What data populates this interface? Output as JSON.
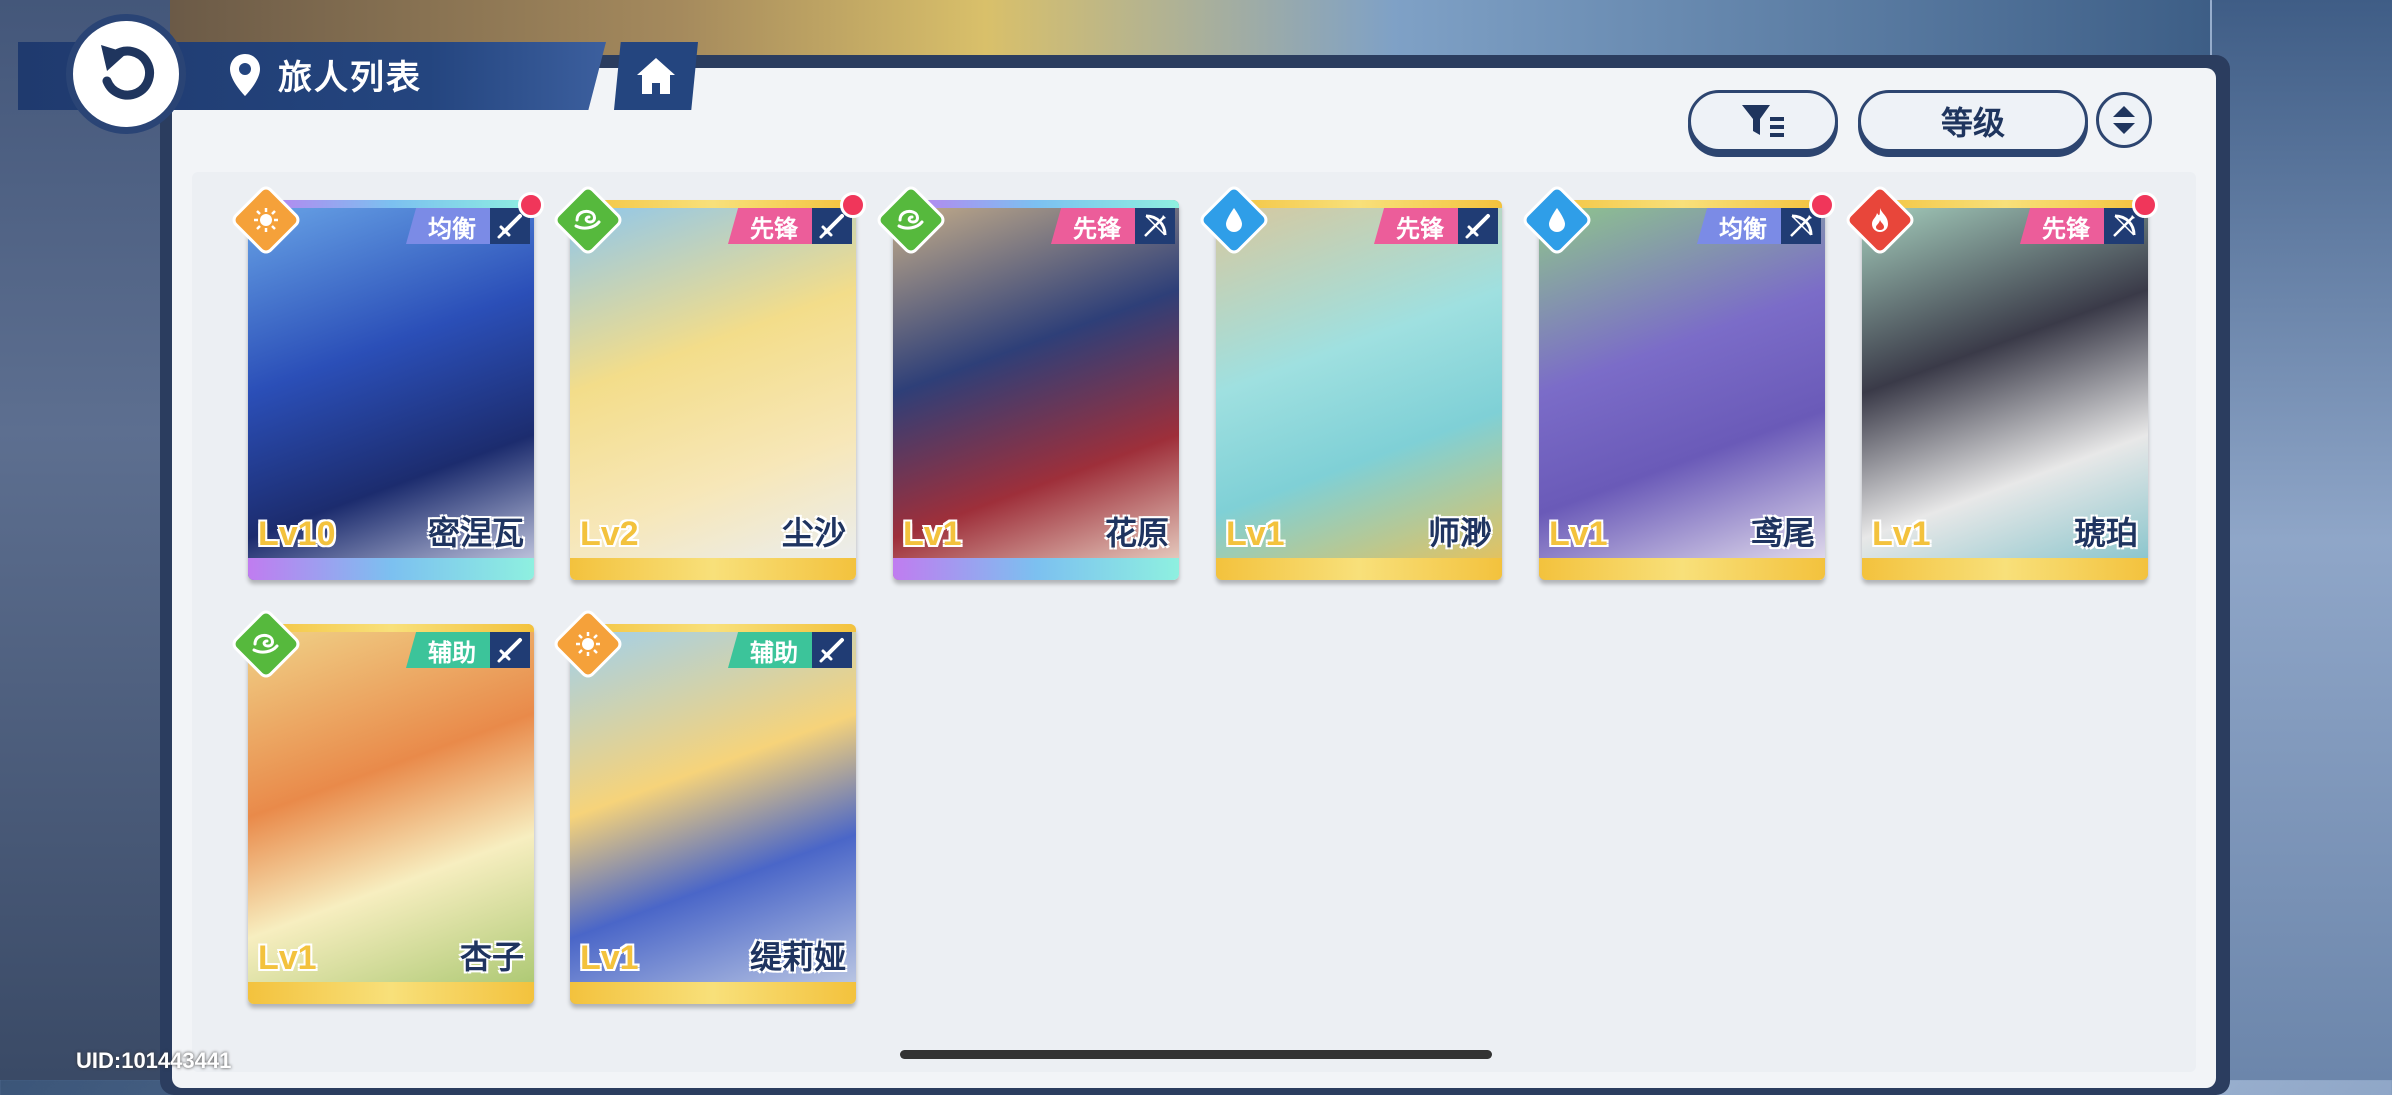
{
  "header": {
    "title": "旅人列表"
  },
  "controls": {
    "sort_label": "等级"
  },
  "colors": {
    "accent_navy": "#24457f",
    "role_balanced": "#7b8be6",
    "role_vanguard": "#ec5d9a",
    "role_support": "#3cc49a",
    "elem_sun": "#f5a13a",
    "elem_wind": "#56b93d",
    "elem_water": "#2f9ee8",
    "elem_fire": "#e8463a",
    "red_dot": "#f0365a"
  },
  "characters": [
    {
      "name": "密涅瓦",
      "level": "Lv10",
      "role": "均衡",
      "element": "sun-icon",
      "weapon": "sword-icon",
      "new": true,
      "rarity": "rainbow"
    },
    {
      "name": "尘沙",
      "level": "Lv2",
      "role": "先锋",
      "element": "wind-icon",
      "weapon": "sword-icon",
      "new": true,
      "rarity": "gold"
    },
    {
      "name": "花原",
      "level": "Lv1",
      "role": "先锋",
      "element": "wind-icon",
      "weapon": "bow-icon",
      "new": false,
      "rarity": "rainbow"
    },
    {
      "name": "师渺",
      "level": "Lv1",
      "role": "先锋",
      "element": "water-icon",
      "weapon": "sword-icon",
      "new": false,
      "rarity": "gold"
    },
    {
      "name": "鸢尾",
      "level": "Lv1",
      "role": "均衡",
      "element": "water-icon",
      "weapon": "bow-icon",
      "new": true,
      "rarity": "gold"
    },
    {
      "name": "琥珀",
      "level": "Lv1",
      "role": "先锋",
      "element": "fire-icon",
      "weapon": "bow-icon",
      "new": true,
      "rarity": "gold"
    },
    {
      "name": "杏子",
      "level": "Lv1",
      "role": "辅助",
      "element": "wind-icon",
      "weapon": "sword-icon",
      "new": false,
      "rarity": "gold"
    },
    {
      "name": "缇莉娅",
      "level": "Lv1",
      "role": "辅助",
      "element": "sun-icon",
      "weapon": "sword-icon",
      "new": false,
      "rarity": "gold"
    }
  ],
  "footer": {
    "uid": "UID:101443441"
  }
}
